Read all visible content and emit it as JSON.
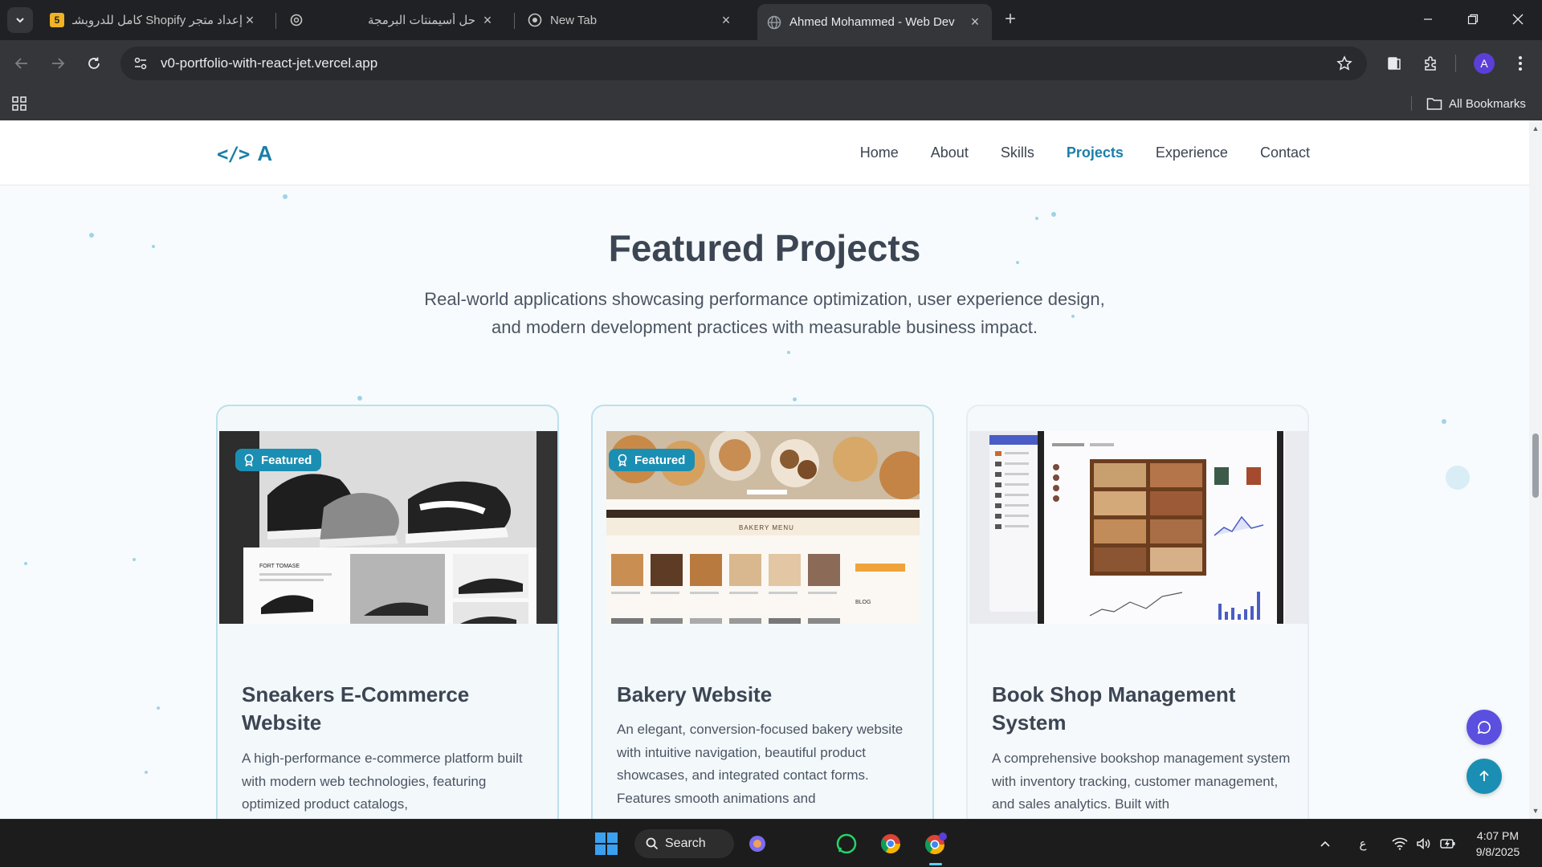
{
  "browser": {
    "tabs": [
      {
        "title": "إعداد متجر Shopify كامل للدروبشـ",
        "favicon_text": "5"
      },
      {
        "title": "حل أسيمنتات البرمجة"
      },
      {
        "title": "New Tab"
      },
      {
        "title": "Ahmed Mohammed - Web Dev",
        "active": true
      }
    ],
    "url": "v0-portfolio-with-react-jet.vercel.app",
    "profile_initial": "A",
    "bookmarks_label": "All Bookmarks"
  },
  "site": {
    "logo_code": "</>",
    "logo_letter": "A",
    "nav": [
      "Home",
      "About",
      "Skills",
      "Projects",
      "Experience",
      "Contact"
    ],
    "active_nav": "Projects",
    "section_title": "Featured Projects",
    "section_subtitle": "Real-world applications showcasing performance optimization, user experience design, and modern development practices with measurable business impact.",
    "projects": [
      {
        "badge": "Featured",
        "title": "Sneakers E-Commerce Website",
        "description": "A high-performance e-commerce platform built with modern web technologies, featuring optimized product catalogs,",
        "thumb_caption": "FORT TOMASE"
      },
      {
        "badge": "Featured",
        "title": "Bakery Website",
        "description": "An elegant, conversion-focused bakery website with intuitive navigation, beautiful product showcases, and integrated contact forms. Features smooth animations and",
        "thumb_caption": "BAKERY MENU",
        "thumb_blog": "BLOG"
      },
      {
        "title": "Book Shop Management System",
        "description": "A comprehensive bookshop management system with inventory tracking, customer management, and sales analytics. Built with"
      }
    ]
  },
  "taskbar": {
    "search_label": "Search",
    "keyboard_lang": "ع",
    "time": "4:07 PM",
    "date": "9/8/2025"
  },
  "colors": {
    "accent": "#1b7fa8",
    "badge": "#1b8fb3",
    "chat_fab": "#5b4fe0",
    "top_fab": "#1b8fb3"
  }
}
